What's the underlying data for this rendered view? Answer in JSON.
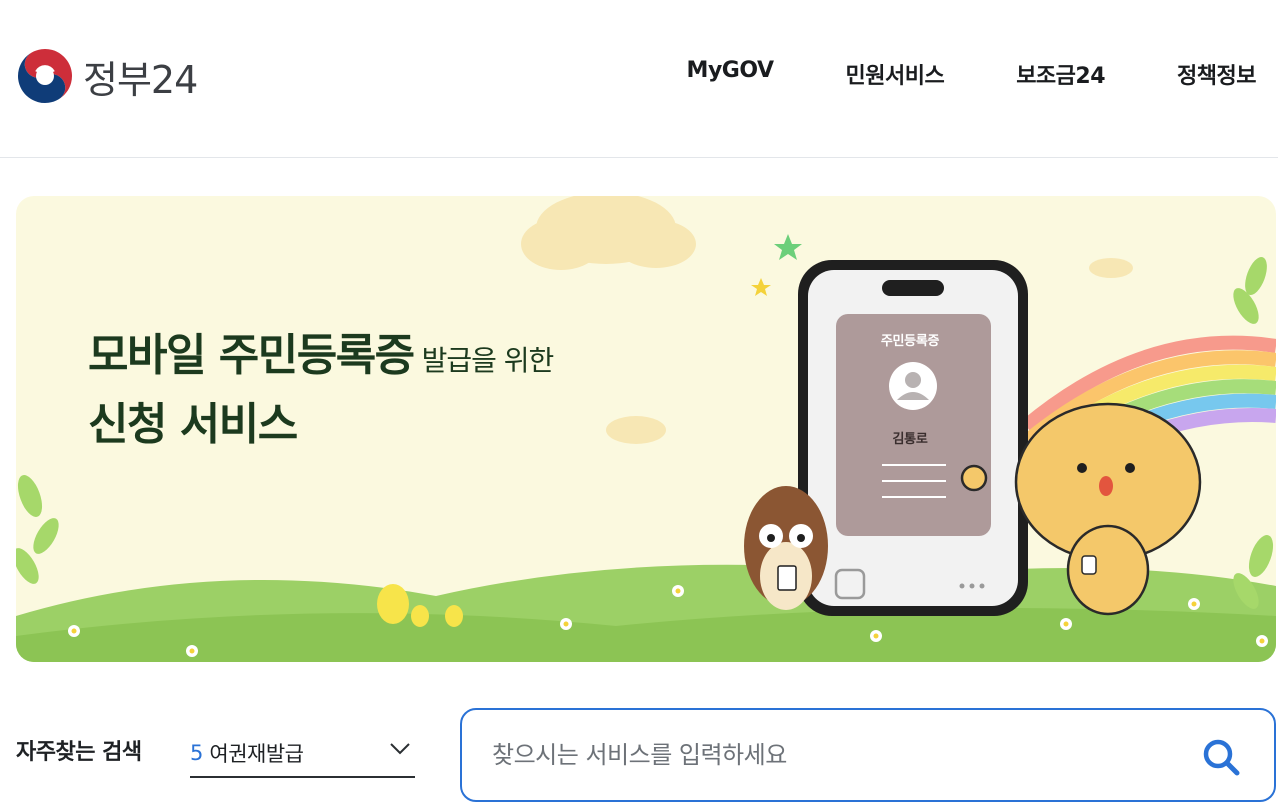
{
  "header": {
    "logo_text": "정부24",
    "nav": [
      "MyGOV",
      "민원서비스",
      "보조금24",
      "정책정보"
    ]
  },
  "banner": {
    "title_line1": "모바일 주민등록증",
    "title_line1_sub": " 발급을 위한",
    "title_line2": "신청 서비스",
    "card_title": "주민등록증",
    "card_name": "김통로"
  },
  "search_section": {
    "quick_label": "자주찾는 검색",
    "selected_rank": "5",
    "selected_value": "여권재발급",
    "placeholder": "찾으시는 서비스를 입력하세요"
  },
  "icons": {
    "logo": "taegeuk-logo-icon",
    "dropdown": "chevron-down-icon",
    "search": "search-icon"
  },
  "colors": {
    "accent": "#2a72d6",
    "banner_bg": "#fbf9df",
    "title_green": "#1c3a1e"
  }
}
